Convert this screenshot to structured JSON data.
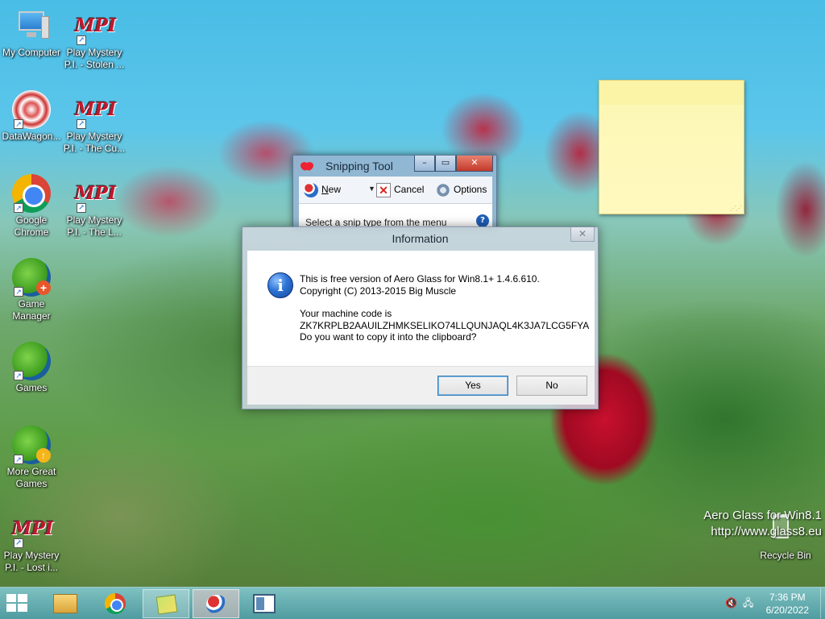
{
  "desktop": {
    "icons": [
      {
        "label": "My Computer",
        "line2": ""
      },
      {
        "label": "Play Mystery",
        "line2": "P.I. - Stolen ..."
      },
      {
        "label": "DataWagon...",
        "line2": ""
      },
      {
        "label": "Play Mystery",
        "line2": "P.I. - The Cu..."
      },
      {
        "label": "Google",
        "line2": "Chrome"
      },
      {
        "label": "Play Mystery",
        "line2": "P.I. - The L..."
      },
      {
        "label": "Game",
        "line2": "Manager"
      },
      {
        "label": "Games",
        "line2": ""
      },
      {
        "label": "More Great",
        "line2": "Games"
      },
      {
        "label": "Play Mystery",
        "line2": "P.I. - Lost i..."
      },
      {
        "label": "Recycle Bin",
        "line2": ""
      }
    ],
    "mpi_logo": "MPI",
    "watermark": {
      "line1": "Aero Glass for Win8.1",
      "line2": "http://www.glass8.eu"
    }
  },
  "snipping_tool": {
    "title": "Snipping Tool",
    "buttons": {
      "minimize": "–",
      "maximize": "▭",
      "close": "✕"
    },
    "toolbar": {
      "new_label": "New",
      "new_mnemonic": "N",
      "new_rest": "ew",
      "dropdown": "▼",
      "cancel_label": "Cancel",
      "options_label": "Options"
    },
    "hint": "Select a snip type from the menu",
    "help": "?"
  },
  "info_dialog": {
    "title": "Information",
    "close": "✕",
    "icon_glyph": "i",
    "lines": [
      "This is free version of Aero Glass for Win8.1+ 1.4.6.610.",
      "Copyright (C) 2013-2015 Big Muscle",
      "Your machine code is",
      "ZK7KRPLB2AAUILZHMKSELIKO74LLQUNJAQL4K3JA7LCG5FYA",
      "Do you want to copy it into the clipboard?"
    ],
    "yes_label": "Yes",
    "no_label": "No"
  },
  "taskbar": {
    "tray": {
      "volume": "🔇",
      "network": "🖧"
    },
    "clock": {
      "time": "7:36 PM",
      "date": "6/20/2022"
    }
  },
  "colors": {
    "taskbar": "#5fa9ad",
    "sticky": "#fff9bf",
    "dialog_accent": "#3c7fb1"
  }
}
